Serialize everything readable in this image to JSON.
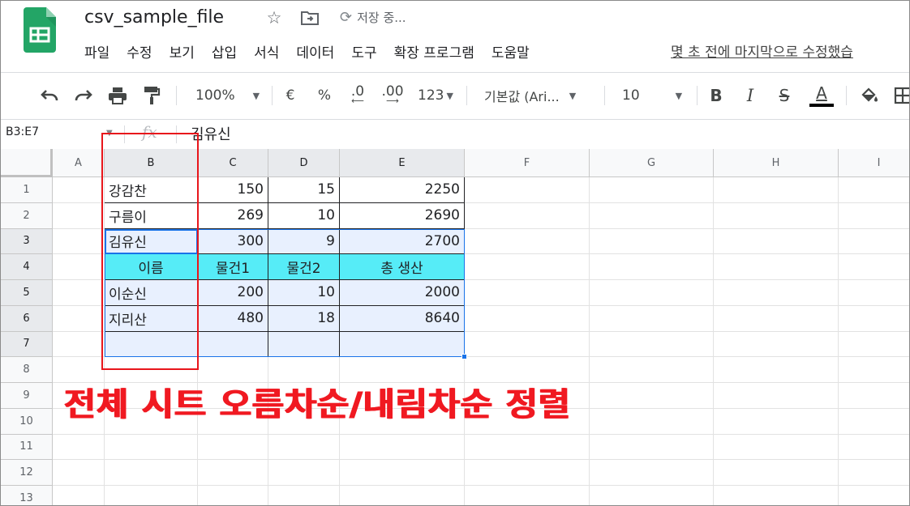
{
  "app": {
    "doc_title": "csv_sample_file",
    "save_status": "저장 중...",
    "last_edit": "몇 초 전에 마지막으로 수정했습"
  },
  "menu": [
    "파일",
    "수정",
    "보기",
    "삽입",
    "서식",
    "데이터",
    "도구",
    "확장 프로그램",
    "도움말"
  ],
  "toolbar": {
    "zoom": "100%",
    "currency": "€",
    "percent": "%",
    "decimal_decrease": ".0",
    "decimal_increase": ".00",
    "number_format": "123",
    "font": "기본값 (Ari...",
    "font_size": "10",
    "bold": "B",
    "italic": "I",
    "strikethrough": "S",
    "text_color_letter": "A"
  },
  "formula_bar": {
    "name_box": "B3:E7",
    "fx": "fx",
    "value": "김유신"
  },
  "grid": {
    "columns": [
      "A",
      "B",
      "C",
      "D",
      "E",
      "F",
      "G",
      "H",
      "I"
    ],
    "rows": [
      "1",
      "2",
      "3",
      "4",
      "5",
      "6",
      "7",
      "8",
      "9",
      "10",
      "11",
      "12",
      "13"
    ],
    "selected_columns": [
      "B",
      "C",
      "D",
      "E"
    ],
    "selected_rows": [
      "3",
      "4",
      "5",
      "6",
      "7"
    ],
    "data": [
      [
        "강감찬",
        "150",
        "15",
        "2250"
      ],
      [
        "구름이",
        "269",
        "10",
        "2690"
      ],
      [
        "김유신",
        "300",
        "9",
        "2700"
      ],
      [
        "이름",
        "물건1",
        "물건2",
        "총 생산"
      ],
      [
        "이순신",
        "200",
        "10",
        "2000"
      ],
      [
        "지리산",
        "480",
        "18",
        "8640"
      ],
      [
        "",
        "",
        "",
        ""
      ]
    ]
  },
  "annotation": {
    "text": "전체 시트 오름차순/내림차순 정렬",
    "color": "#f01921"
  },
  "colors": {
    "header_fill": "#56ecf7",
    "selection": "#1a73e8",
    "selection_fill": "#e8f0fe",
    "sheets_green": "#23a566"
  }
}
